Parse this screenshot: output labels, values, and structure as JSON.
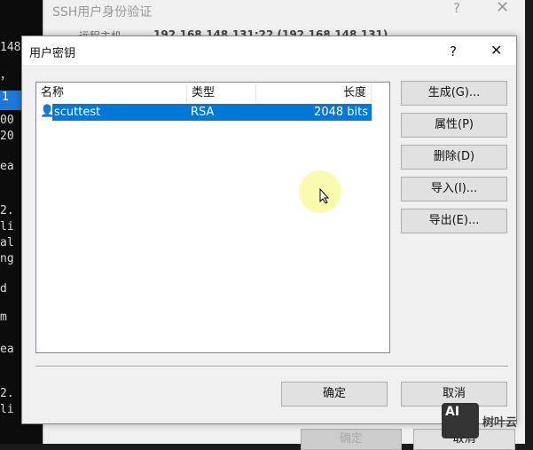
{
  "terminal": {
    "lines": [
      "148",
      "，",
      "1",
      "00",
      "20",
      "ea",
      "2.",
      "li",
      "al",
      "ng",
      "d",
      "m",
      "ea",
      "2.",
      "li"
    ]
  },
  "parent_dialog": {
    "title": "SSH用户身份验证",
    "help": "?",
    "close": "✕",
    "host_label": "远程主机",
    "host_value": "192.168.148.131:22 (192.168.148.131)",
    "ok": "确定",
    "cancel": "取消"
  },
  "dialog": {
    "title": "用户密钥",
    "help": "?",
    "close": "✕",
    "columns": [
      "名称",
      "类型",
      "长度"
    ],
    "rows": [
      {
        "name": "scuttest",
        "type": "RSA",
        "length": "2048 bits"
      }
    ],
    "buttons": [
      "生成(G)...",
      "属性(P)",
      "删除(D)",
      "导入(I)...",
      "导出(E)..."
    ],
    "ok": "确定",
    "cancel": "取消"
  },
  "watermark": {
    "logo": "AI",
    "text": "树叶云"
  }
}
